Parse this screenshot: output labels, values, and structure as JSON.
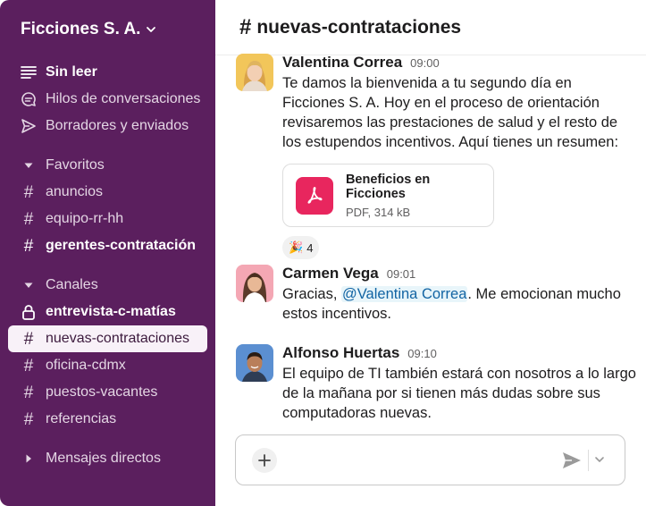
{
  "workspace": {
    "name": "Ficciones S. A."
  },
  "nav": {
    "unread": "Sin leer",
    "threads": "Hilos de conversaciones",
    "drafts": "Borradores y enviados"
  },
  "favorites": {
    "title": "Favoritos",
    "items": [
      "anuncios",
      "equipo-rr-hh",
      "gerentes-contratación"
    ]
  },
  "channels": {
    "title": "Canales",
    "items": [
      "entrevista-c-matías",
      "nuevas-contrataciones",
      "oficina-cdmx",
      "puestos-vacantes",
      "referencias"
    ]
  },
  "direct_messages": {
    "title": "Mensajes directos"
  },
  "header": {
    "channel": "nuevas-contrataciones",
    "hash": "#"
  },
  "messages": [
    {
      "author": "Valentina Correa",
      "time": "09:00",
      "text": "Te damos la bienvenida a tu segundo día en Ficciones S. A. Hoy en el proceso de orientación revisaremos las prestaciones de salud y el resto de los estupendos incentivos. Aquí tienes un resumen:",
      "file": {
        "name": "Beneficios en Ficciones",
        "meta": "PDF, 314 kB"
      },
      "reaction": {
        "emoji": "🎉",
        "count": "4"
      }
    },
    {
      "author": "Carmen Vega",
      "time": "09:01",
      "text_before": "Gracias, ",
      "mention": "@Valentina Correa",
      "text_after": ". Me emocionan mucho estos incentivos."
    },
    {
      "author": "Alfonso Huertas",
      "time": "09:10",
      "text": "El equipo de TI también estará con nosotros a lo largo de la mañana por si tienen más dudas sobre sus computadoras nuevas."
    }
  ],
  "colors": {
    "sidebar": "#5b1f5e",
    "active_item": "#f8f1f8",
    "pdf_icon": "#e8265e",
    "mention": "#1264a3"
  }
}
